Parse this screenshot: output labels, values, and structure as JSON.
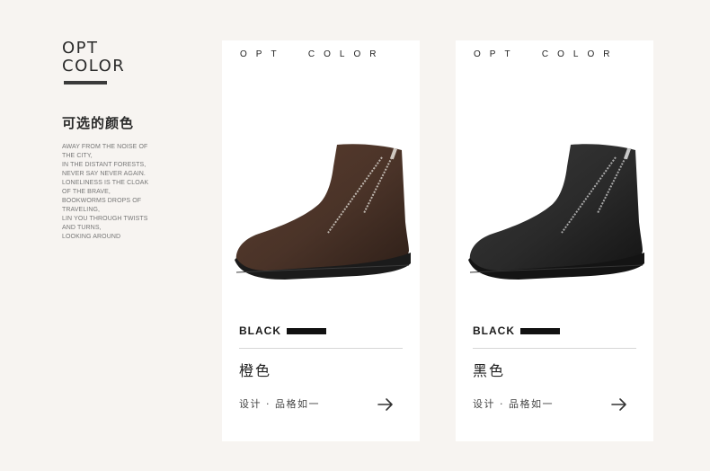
{
  "intro": {
    "title_line1": "OPT",
    "title_line2": "COLOR",
    "heading_cn": "可选的颜色",
    "poem_lines": [
      "AWAY FROM THE NOISE OF",
      "THE CITY,",
      "IN THE DISTANT FORESTS,",
      "NEVER SAY NEVER AGAIN.",
      "LONELINESS IS THE CLOAK",
      "OF THE BRAVE,",
      "BOOKWORMS DROPS OF",
      "TRAVELING,",
      "LIN YOU THROUGH TWISTS",
      "AND TURNS,",
      "LOOKING AROUND"
    ]
  },
  "cards": [
    {
      "header": "OPT  COLOR",
      "label": "BLACK",
      "color_name": "橙色",
      "tagline": "设计 · 品格如一",
      "boot_color": "#4a3328",
      "boot_icon": "brown-boot-icon"
    },
    {
      "header": "OPT  COLOR",
      "label": "BLACK",
      "color_name": "黑色",
      "tagline": "设计 · 品格如一",
      "boot_color": "#2a2a2a",
      "boot_icon": "black-boot-icon"
    }
  ],
  "colors": {
    "background": "#f7f4f1",
    "card": "#ffffff",
    "accent": "#111111"
  }
}
